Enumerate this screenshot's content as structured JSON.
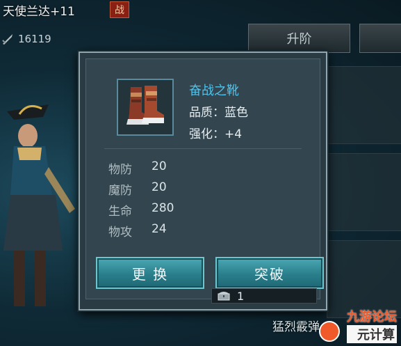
{
  "hero": {
    "name": "天使兰达+11",
    "badge": "战",
    "power": "16119"
  },
  "tabs": {
    "upgrade_label": "升阶"
  },
  "bottom": {
    "skill_text": "猛烈霰弹"
  },
  "watermark": {
    "main": "九游论坛",
    "sub": "元计算"
  },
  "item": {
    "name": "奋战之靴",
    "quality": "品质：蓝色",
    "enhance": "强化：+4",
    "icon": "boots-icon"
  },
  "stats": [
    {
      "name": "物防",
      "value": "20"
    },
    {
      "name": "魔防",
      "value": "20"
    },
    {
      "name": "生命",
      "value": "280"
    },
    {
      "name": "物攻",
      "value": "24"
    }
  ],
  "buttons": {
    "replace": "更 换",
    "breakthrough": "突破"
  },
  "cost": {
    "icon": "chest-icon",
    "value": "1"
  },
  "colors": {
    "item_name": "#4fc3ec",
    "button": "#2a7f8c",
    "popup_border": "#8fa6b0"
  }
}
